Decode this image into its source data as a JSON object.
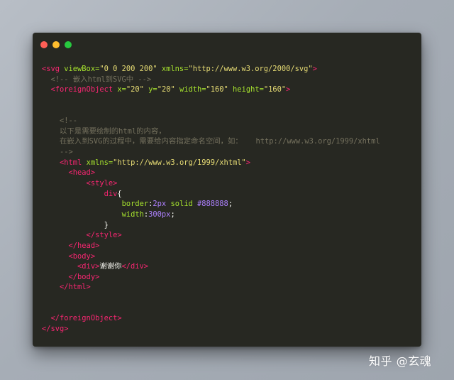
{
  "code": {
    "lines": [
      {
        "segs": [
          {
            "c": "t",
            "t": "<svg "
          },
          {
            "c": "a",
            "t": "viewBox="
          },
          {
            "c": "s",
            "t": "\"0 0 200 200\""
          },
          {
            "c": "a",
            "t": " xmlns="
          },
          {
            "c": "s",
            "t": "\"http://www.w3.org/2000/svg\""
          },
          {
            "c": "t",
            "t": ">"
          }
        ]
      },
      {
        "segs": [
          {
            "c": "c",
            "t": "  <!-- 嵌入html到SVG中 -->"
          }
        ]
      },
      {
        "segs": [
          {
            "c": "t",
            "t": "  <foreignObject "
          },
          {
            "c": "a",
            "t": "x="
          },
          {
            "c": "s",
            "t": "\"20\""
          },
          {
            "c": "a",
            "t": " y="
          },
          {
            "c": "s",
            "t": "\"20\""
          },
          {
            "c": "a",
            "t": " width="
          },
          {
            "c": "s",
            "t": "\"160\""
          },
          {
            "c": "a",
            "t": " height="
          },
          {
            "c": "s",
            "t": "\"160\""
          },
          {
            "c": "t",
            "t": ">"
          }
        ]
      },
      {
        "segs": []
      },
      {
        "segs": []
      },
      {
        "segs": [
          {
            "c": "c",
            "t": "    <!--"
          }
        ]
      },
      {
        "segs": [
          {
            "c": "c",
            "t": "    以下是需要绘制的html的内容，"
          }
        ]
      },
      {
        "segs": [
          {
            "c": "c",
            "t": "    在嵌入到SVG的过程中，需要给内容指定命名空间，如：   http://www.w3.org/1999/xhtml"
          }
        ]
      },
      {
        "segs": [
          {
            "c": "c",
            "t": "    -->"
          }
        ]
      },
      {
        "segs": [
          {
            "c": "t",
            "t": "    <html "
          },
          {
            "c": "a",
            "t": "xmlns="
          },
          {
            "c": "s",
            "t": "\"http://www.w3.org/1999/xhtml\""
          },
          {
            "c": "t",
            "t": ">"
          }
        ]
      },
      {
        "segs": [
          {
            "c": "t",
            "t": "      <head>"
          }
        ]
      },
      {
        "segs": [
          {
            "c": "t",
            "t": "          <style>"
          }
        ]
      },
      {
        "segs": [
          {
            "c": "t",
            "t": "              div"
          },
          {
            "c": "p",
            "t": "{"
          }
        ]
      },
      {
        "segs": [
          {
            "c": "k",
            "t": "                  border"
          },
          {
            "c": "p",
            "t": ":"
          },
          {
            "c": "v",
            "t": "2px"
          },
          {
            "c": "k",
            "t": " solid "
          },
          {
            "c": "v",
            "t": "#888888"
          },
          {
            "c": "p",
            "t": ";"
          }
        ]
      },
      {
        "segs": [
          {
            "c": "k",
            "t": "                  width"
          },
          {
            "c": "p",
            "t": ":"
          },
          {
            "c": "v",
            "t": "300px"
          },
          {
            "c": "p",
            "t": ";"
          }
        ]
      },
      {
        "segs": [
          {
            "c": "p",
            "t": "              }"
          }
        ]
      },
      {
        "segs": [
          {
            "c": "t",
            "t": "          </style>"
          }
        ]
      },
      {
        "segs": [
          {
            "c": "t",
            "t": "      </head>"
          }
        ]
      },
      {
        "segs": [
          {
            "c": "t",
            "t": "      <body>"
          }
        ]
      },
      {
        "segs": [
          {
            "c": "t",
            "t": "        <div>"
          },
          {
            "c": "p",
            "t": "谢谢你"
          },
          {
            "c": "t",
            "t": "</div>"
          }
        ]
      },
      {
        "segs": [
          {
            "c": "t",
            "t": "      </body>"
          }
        ]
      },
      {
        "segs": [
          {
            "c": "t",
            "t": "    </html>"
          }
        ]
      },
      {
        "segs": []
      },
      {
        "segs": []
      },
      {
        "segs": [
          {
            "c": "t",
            "t": "  </foreignObject>"
          }
        ]
      },
      {
        "segs": [
          {
            "c": "t",
            "t": "</svg>"
          }
        ]
      }
    ]
  },
  "watermark": "知乎 @玄魂"
}
